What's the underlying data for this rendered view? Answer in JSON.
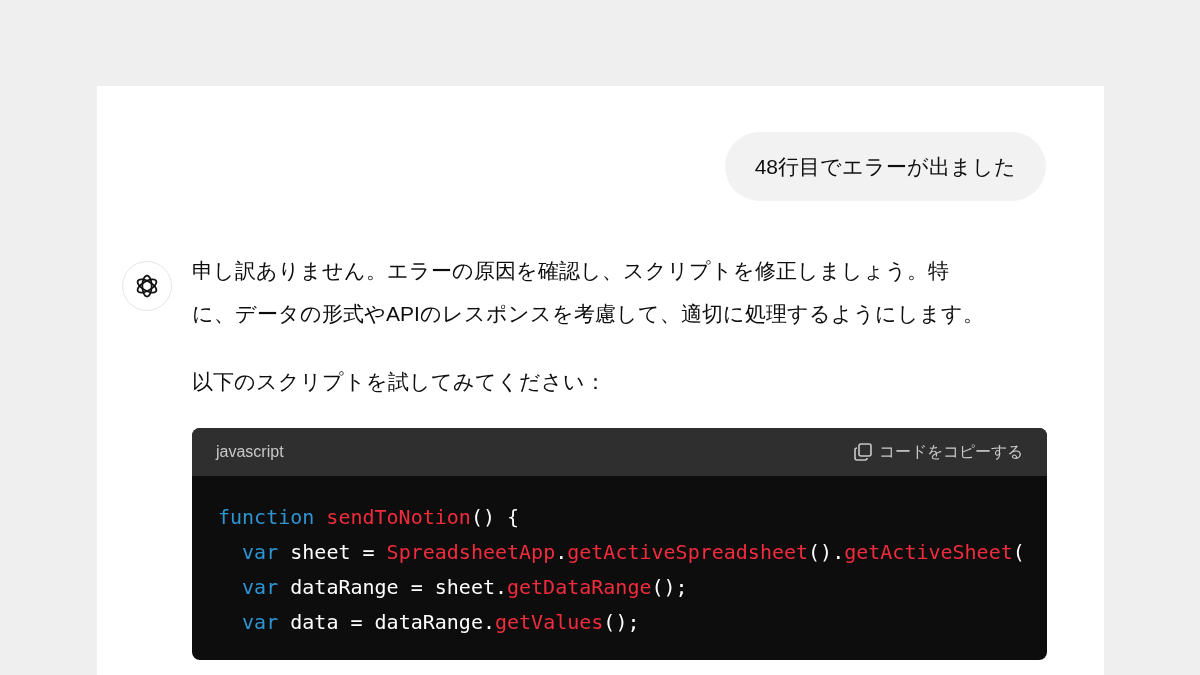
{
  "user_message": "48行目でエラーが出ました",
  "assistant": {
    "paragraphs": [
      [
        "申し訳ありません。エラーの原因を確認し、スクリプトを修正しましょう。特",
        "に、データの形式やAPIのレスポンスを考慮して、適切に処理するようにします。"
      ],
      [
        "以下のスクリプトを試してみてください："
      ]
    ],
    "code_block": {
      "language": "javascript",
      "copy_label": "コードをコピーする",
      "lines": [
        [
          {
            "kind": "keyword",
            "text": "function"
          },
          {
            "kind": "call",
            "text": " sendToNotion"
          },
          {
            "kind": "plain",
            "text": "() {"
          }
        ],
        [
          {
            "kind": "keyword",
            "text": "  var"
          },
          {
            "kind": "plain",
            "text": " sheet = "
          },
          {
            "kind": "call",
            "text": "SpreadsheetApp"
          },
          {
            "kind": "plain",
            "text": "."
          },
          {
            "kind": "call",
            "text": "getActiveSpreadsheet"
          },
          {
            "kind": "plain",
            "text": "()."
          },
          {
            "kind": "call",
            "text": "getActiveSheet"
          },
          {
            "kind": "plain",
            "text": "("
          }
        ],
        [
          {
            "kind": "keyword",
            "text": "  var"
          },
          {
            "kind": "plain",
            "text": " dataRange = sheet."
          },
          {
            "kind": "call",
            "text": "getDataRange"
          },
          {
            "kind": "plain",
            "text": "();"
          }
        ],
        [
          {
            "kind": "keyword",
            "text": "  var"
          },
          {
            "kind": "plain",
            "text": " data = dataRange."
          },
          {
            "kind": "call",
            "text": "getValues"
          },
          {
            "kind": "plain",
            "text": "();"
          }
        ]
      ]
    }
  }
}
